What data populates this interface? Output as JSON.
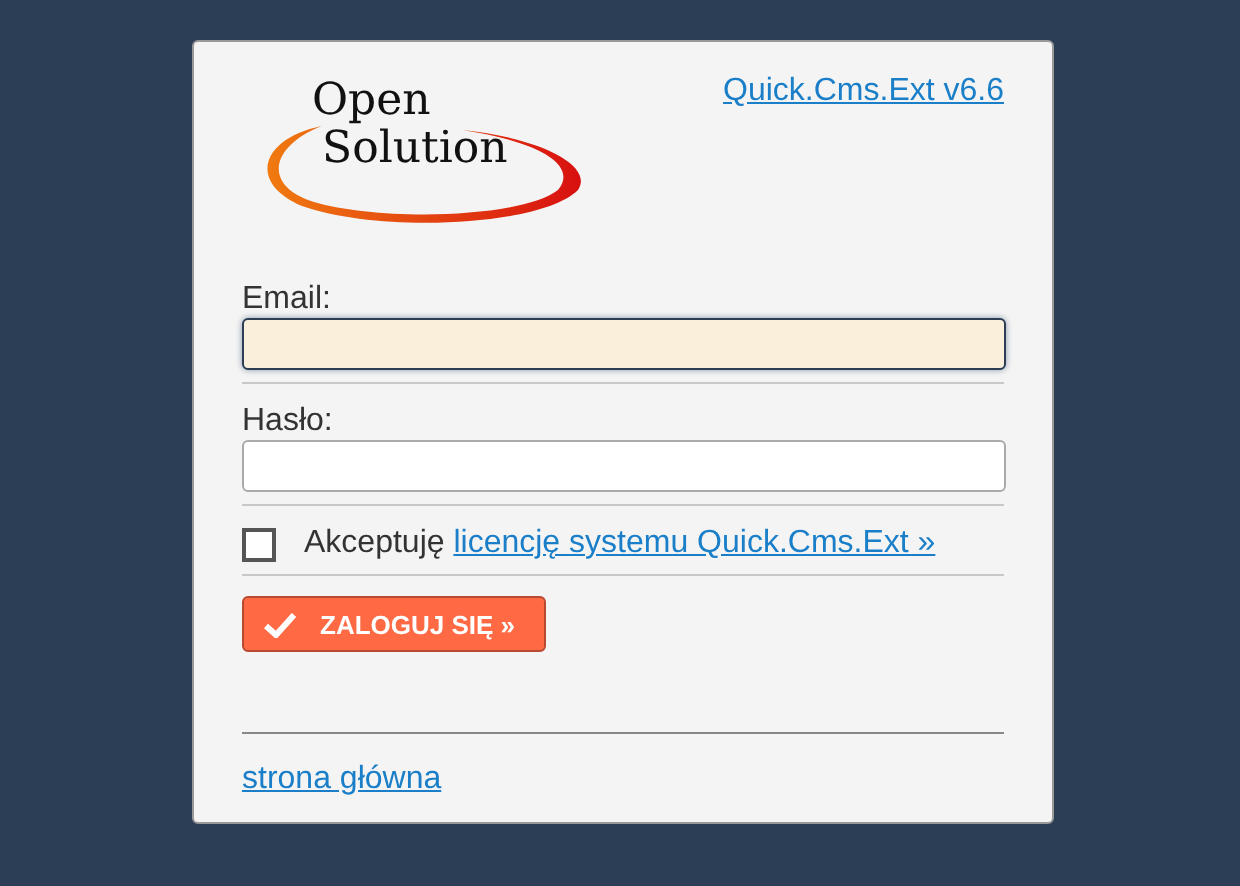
{
  "logo": {
    "line_1": "Open",
    "line_2": "Solution"
  },
  "version_link": "Quick.Cms.Ext v6.6",
  "fields": [
    {
      "label": "Email:",
      "focused": true
    },
    {
      "label": "Hasło:",
      "focused": false
    }
  ],
  "license": {
    "checked": false,
    "text": "Akceptuję",
    "link": "licencję systemu Quick.Cms.Ext »"
  },
  "login_button": "ZALOGUJ SIĘ »",
  "home_link": "strona główna"
}
